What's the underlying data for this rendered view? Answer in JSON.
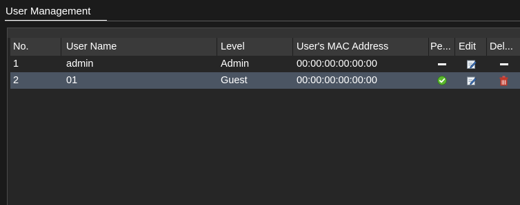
{
  "page": {
    "title": "User Management"
  },
  "table": {
    "columns": [
      "No.",
      "User Name",
      "Level",
      "User's MAC Address",
      "Pe...",
      "Edit",
      "Del..."
    ],
    "rows": [
      {
        "no": "1",
        "user_name": "admin",
        "level": "Admin",
        "mac": "00:00:00:00:00:00",
        "permission_icon": "dash-icon",
        "edit_icon": "edit-icon",
        "delete_icon": "dash-icon",
        "selected": false
      },
      {
        "no": "2",
        "user_name": "01",
        "level": "Guest",
        "mac": "00:00:00:00:00:00",
        "permission_icon": "check-circle-icon",
        "edit_icon": "edit-icon",
        "delete_icon": "trash-icon",
        "selected": true
      }
    ]
  },
  "colors": {
    "background": "#1a1a1a",
    "panel": "#262626",
    "header_row": "#3a3a3a",
    "selected_row": "#4b5563",
    "check": "#5cb82e",
    "trash": "#c0392b"
  }
}
